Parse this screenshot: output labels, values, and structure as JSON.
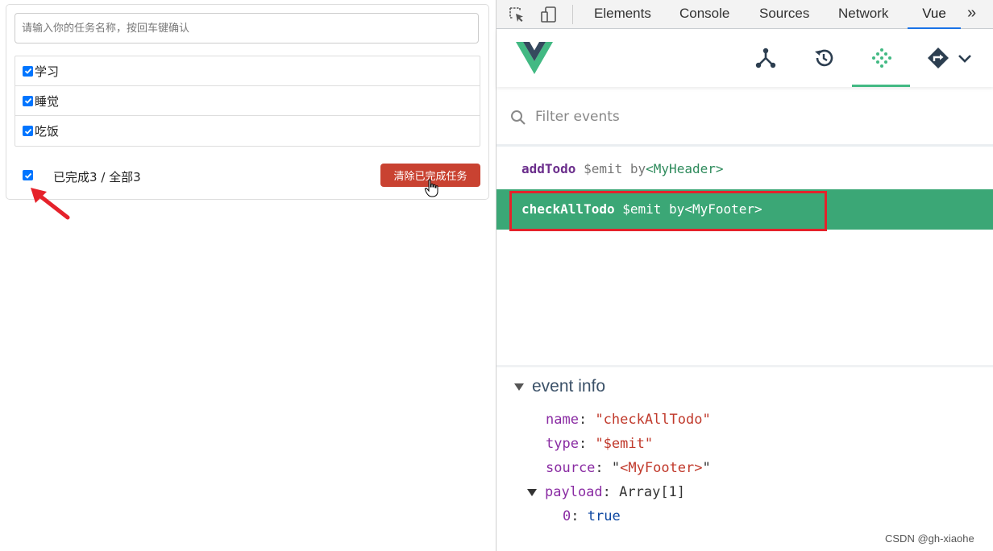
{
  "todo": {
    "input_placeholder": "请输入你的任务名称，按回车键确认",
    "items": [
      {
        "label": "学习",
        "checked": true
      },
      {
        "label": "睡觉",
        "checked": true
      },
      {
        "label": "吃饭",
        "checked": true
      }
    ],
    "footer": {
      "check_all": true,
      "done_label": "已完成3",
      "separator": " / ",
      "total_label": "全部3",
      "clear_button": "清除已完成任务"
    }
  },
  "devtools": {
    "tabs": [
      {
        "label": "Elements",
        "active": false
      },
      {
        "label": "Console",
        "active": false
      },
      {
        "label": "Sources",
        "active": false
      },
      {
        "label": "Network",
        "active": false
      },
      {
        "label": "Vue",
        "active": true
      }
    ],
    "more_tabs": "»",
    "vue_toolbar": {
      "logo": "vue-logo",
      "icons": [
        "components-icon",
        "vuex-history-icon",
        "events-icon",
        "routing-icon",
        "chevron-down-icon"
      ],
      "active": "events-icon",
      "accent": "#42b983"
    },
    "filter_placeholder": "Filter events",
    "events": [
      {
        "name": "addTodo",
        "emit": "$emit",
        "by": "by",
        "component": "<MyHeader>",
        "selected": false
      },
      {
        "name": "checkAllTodo",
        "emit": "$emit",
        "by": "by",
        "component": "<MyFooter>",
        "selected": true
      }
    ],
    "event_info": {
      "header": "event info",
      "name_key": "name",
      "name_value": "\"checkAllTodo\"",
      "type_key": "type",
      "type_value": "\"$emit\"",
      "source_key": "source",
      "source_q1": "\"",
      "source_value": "<MyFooter>",
      "source_q2": "\"",
      "payload_key": "payload",
      "payload_value": "Array[1]",
      "item_index": "0",
      "item_value": "true"
    }
  },
  "watermark": "CSDN @gh-xiaohe",
  "colors": {
    "selected_row": "#3ba776",
    "highlight": "#e5222b",
    "clear_button": "#c94231",
    "annotation_arrow": "#e5222b"
  }
}
